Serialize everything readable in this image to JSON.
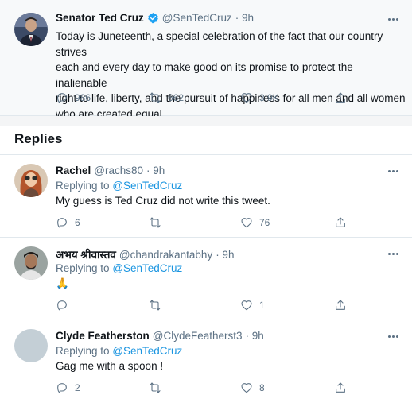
{
  "main_tweet": {
    "name": "Senator Ted Cruz",
    "verified": true,
    "handle": "@SenTedCruz",
    "time": "· 9h",
    "text_lines": [
      "Today is Juneteenth, a special celebration of the fact that our country strives",
      "each and every day to make good on its promise to protect the inalienable",
      "right to life, liberty, and the pursuit of happiness for all men and all women",
      "who are created equal."
    ],
    "stats": {
      "replies": "986",
      "retweets": "662",
      "likes": "3.9K"
    }
  },
  "replies_heading": "Replies",
  "replies": [
    {
      "name": "Rachel",
      "handle": "@rachs80",
      "time": "· 9h",
      "replying_prefix": "Replying to",
      "replying_to": "@SenTedCruz",
      "text": "My guess is Ted Cruz did not write this tweet.",
      "stats": {
        "replies": "6",
        "retweets": "",
        "likes": "76"
      }
    },
    {
      "name": "अभय श्रीवास्तव",
      "handle": "@chandrakantabhy",
      "time": "· 9h",
      "replying_prefix": "Replying to",
      "replying_to": "@SenTedCruz",
      "text": "🙏",
      "stats": {
        "replies": "",
        "retweets": "",
        "likes": "1"
      }
    },
    {
      "name": "Clyde Featherston",
      "handle": "@ClydeFeatherst3",
      "time": "· 9h",
      "replying_prefix": "Replying to",
      "replying_to": "@SenTedCruz",
      "text": "Gag me with a spoon !",
      "stats": {
        "replies": "2",
        "retweets": "",
        "likes": "8"
      }
    }
  ],
  "colors": {
    "accent": "#1b95e0",
    "verified": "#1da1f2",
    "muted": "#5b7083"
  }
}
